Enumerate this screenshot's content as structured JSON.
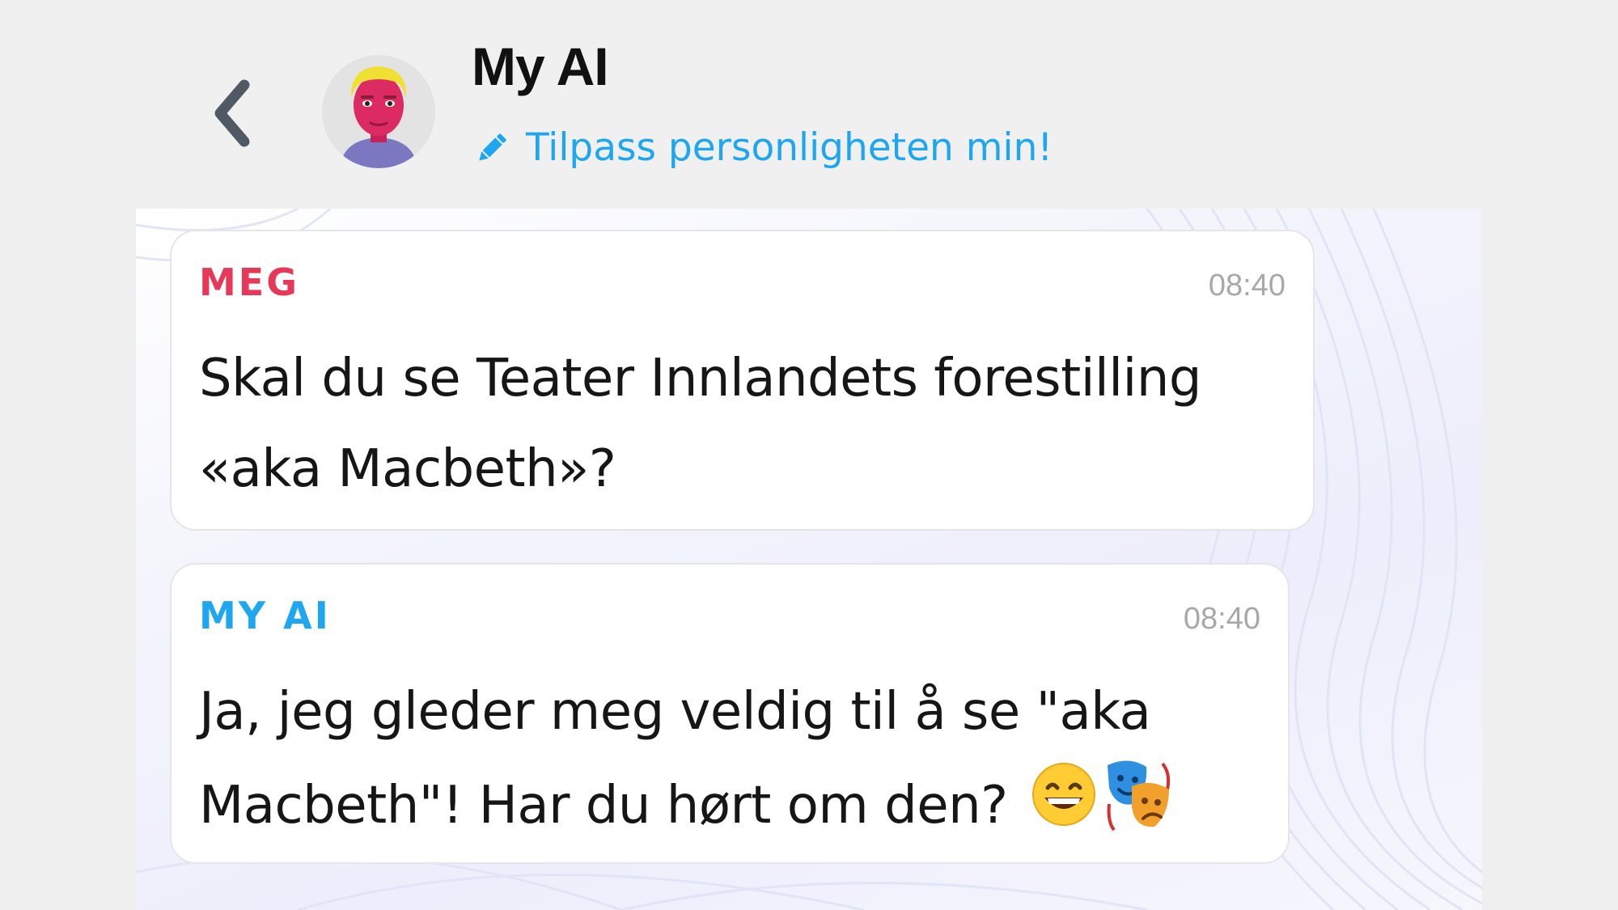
{
  "header": {
    "title": "My AI",
    "customize_label": "Tilpass personligheten min!"
  },
  "messages": [
    {
      "sender": "MEG",
      "time": "08:40",
      "text": "Skal du se Teater Innlandets forestilling «aka Macbeth»?"
    },
    {
      "sender": "MY AI",
      "time": "08:40",
      "text": "Ja, jeg gleder meg veldig til å se \"aka Macbeth\"! Har du hørt om den?",
      "emojis": [
        "grinning-face-emoji",
        "performing-arts-emoji"
      ]
    }
  ],
  "colors": {
    "accent_blue": "#1ea7f0",
    "me_red": "#e8385a",
    "avatar_skin": "#dc2a62",
    "avatar_hair": "#f0e033",
    "avatar_shirt": "#7b77c0"
  },
  "icons": {
    "back": "chevron-left-icon",
    "customize": "pencil-icon"
  }
}
